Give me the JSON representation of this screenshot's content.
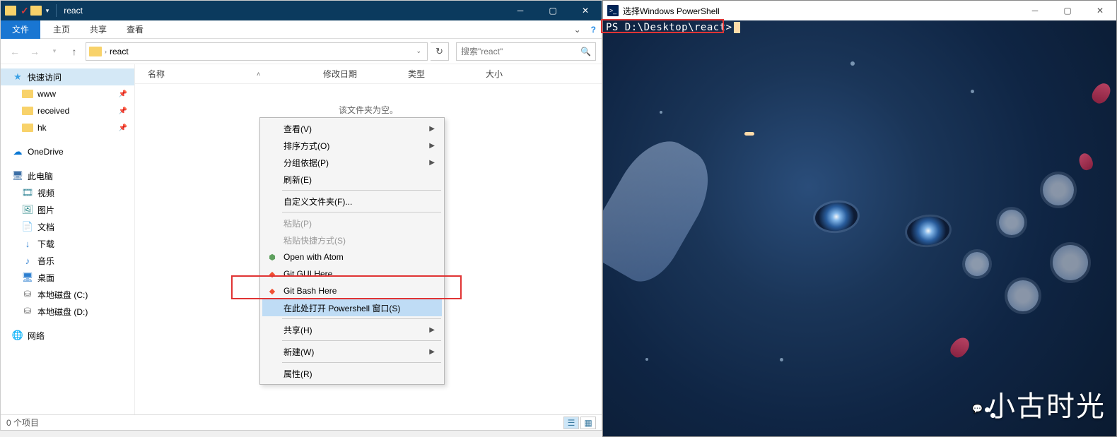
{
  "explorer": {
    "title": "react",
    "ribbon": {
      "file": "文件",
      "home": "主页",
      "share": "共享",
      "view": "查看"
    },
    "address": {
      "path": "react"
    },
    "search": {
      "placeholder": "搜索\"react\""
    },
    "columns": {
      "name": "名称",
      "date": "修改日期",
      "type": "类型",
      "size": "大小"
    },
    "empty": "该文件夹为空。",
    "sidebar": {
      "quick": "快速访问",
      "www": "www",
      "received": "received",
      "hk": "hk",
      "onedrive": "OneDrive",
      "thispc": "此电脑",
      "video": "视频",
      "image": "图片",
      "doc": "文档",
      "down": "下载",
      "music": "音乐",
      "desk": "桌面",
      "disk_c": "本地磁盘 (C:)",
      "disk_d": "本地磁盘 (D:)",
      "network": "网络"
    },
    "status": "0 个项目"
  },
  "contextmenu": {
    "view": "查看(V)",
    "sort": "排序方式(O)",
    "group": "分组依据(P)",
    "refresh": "刷新(E)",
    "customize": "自定义文件夹(F)...",
    "paste": "粘贴(P)",
    "paste_shortcut": "粘贴快捷方式(S)",
    "open_atom": "Open with Atom",
    "git_gui": "Git GUI Here",
    "git_bash": "Git Bash Here",
    "powershell": "在此处打开 Powershell 窗口(S)",
    "share": "共享(H)",
    "new": "新建(W)",
    "props": "属性(R)"
  },
  "powershell": {
    "title": "选择Windows PowerShell",
    "prompt": "PS D:\\Desktop\\react>"
  },
  "watermark": "小古时光"
}
